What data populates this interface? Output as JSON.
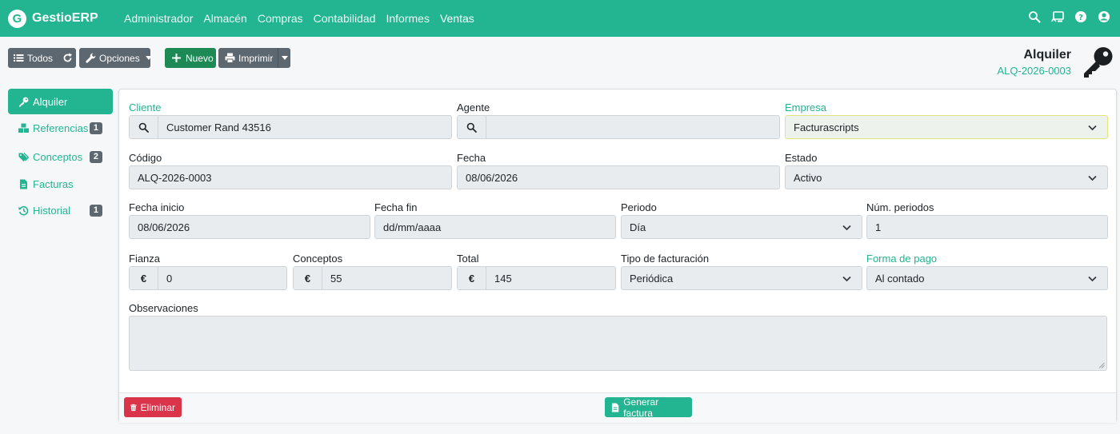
{
  "app": {
    "logo_letter": "G",
    "name": "GestioERP"
  },
  "nav": {
    "items": [
      "Administrador",
      "Almacén",
      "Compras",
      "Contabilidad",
      "Informes",
      "Ventas"
    ]
  },
  "toolbar": {
    "todos": "Todos",
    "opciones": "Opciones",
    "nuevo": "Nuevo",
    "imprimir": "Imprimir"
  },
  "record": {
    "title": "Alquiler",
    "code": "ALQ-2026-0003"
  },
  "sidebar": {
    "items": [
      {
        "label": "Alquiler",
        "badge": ""
      },
      {
        "label": "Referencias",
        "badge": "1"
      },
      {
        "label": "Conceptos",
        "badge": "2"
      },
      {
        "label": "Facturas",
        "badge": ""
      },
      {
        "label": "Historial",
        "badge": "1"
      }
    ]
  },
  "form": {
    "cliente": {
      "label": "Cliente",
      "value": "Customer Rand 43516"
    },
    "agente": {
      "label": "Agente",
      "value": ""
    },
    "empresa": {
      "label": "Empresa",
      "value": "Facturascripts"
    },
    "codigo": {
      "label": "Código",
      "value": "ALQ-2026-0003"
    },
    "fecha": {
      "label": "Fecha",
      "value": "08/06/2026"
    },
    "estado": {
      "label": "Estado",
      "value": "Activo"
    },
    "fecha_inicio": {
      "label": "Fecha inicio",
      "value": "08/06/2026"
    },
    "fecha_fin": {
      "label": "Fecha fin",
      "value": "dd/mm/aaaa"
    },
    "periodo": {
      "label": "Periodo",
      "value": "Día"
    },
    "num_periodos": {
      "label": "Núm. periodos",
      "value": "1"
    },
    "fianza": {
      "label": "Fianza",
      "value": "0"
    },
    "conceptos": {
      "label": "Conceptos",
      "value": "55"
    },
    "total": {
      "label": "Total",
      "value": "145"
    },
    "tipo_facturacion": {
      "label": "Tipo de facturación",
      "value": "Periódica"
    },
    "forma_pago": {
      "label": "Forma de pago",
      "value": "Al contado"
    },
    "observaciones": {
      "label": "Observaciones",
      "value": ""
    },
    "currency_symbol": "€"
  },
  "footer": {
    "eliminar": "Eliminar",
    "generar": "Generar factura"
  },
  "colors": {
    "brand": "#23b592",
    "danger": "#d9344a",
    "success": "#1d8a55",
    "secondary": "#5c6770"
  }
}
